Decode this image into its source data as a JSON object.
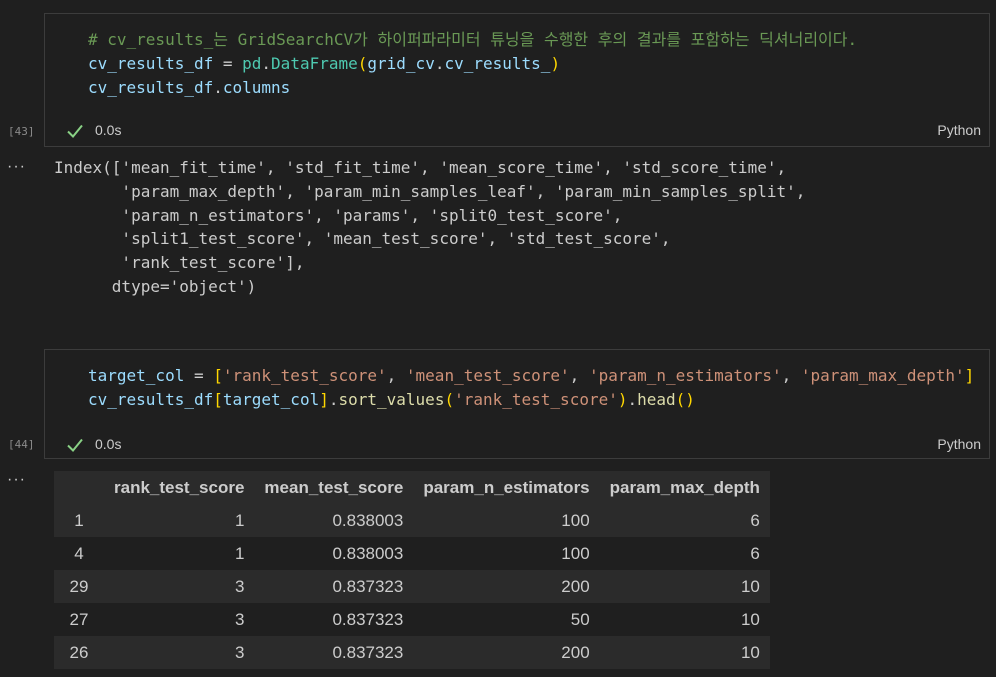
{
  "cell1": {
    "exec_count": "[43]",
    "comment": "# cv_results_는 GridSearchCV가 하이퍼파라미터 튜닝을 수행한 후의 결과를 포함하는 딕셔너리이다.",
    "line2": {
      "var": "cv_results_df",
      "op": " = ",
      "mod": "pd",
      "dot": ".",
      "cls": "DataFrame",
      "open": "(",
      "arg1": "grid_cv",
      "dot2": ".",
      "arg2": "cv_results_",
      "close": ")"
    },
    "line3": {
      "var": "cv_results_df",
      "dot": ".",
      "attr": "columns"
    },
    "time": "0.0s",
    "language": "Python"
  },
  "output1": {
    "lines": [
      "Index(['mean_fit_time', 'std_fit_time', 'mean_score_time', 'std_score_time',",
      "       'param_max_depth', 'param_min_samples_leaf', 'param_min_samples_split',",
      "       'param_n_estimators', 'params', 'split0_test_score',",
      "       'split1_test_score', 'mean_test_score', 'std_test_score',",
      "       'rank_test_score'],",
      "      dtype='object')"
    ]
  },
  "cell2": {
    "exec_count": "[44]",
    "line1": {
      "var": "target_col",
      "op": " = ",
      "open": "[",
      "s1": "'rank_test_score'",
      "s2": "'mean_test_score'",
      "s3": "'param_n_estimators'",
      "s4": "'param_max_depth'",
      "sep": ", ",
      "close": "]"
    },
    "line2": {
      "var": "cv_results_df",
      "open": "[",
      "idx": "target_col",
      "close": "]",
      "dot": ".",
      "fn1": "sort_values",
      "p1o": "(",
      "arg": "'rank_test_score'",
      "p1c": ")",
      "dot2": ".",
      "fn2": "head",
      "p2": "()"
    },
    "time": "0.0s",
    "language": "Python"
  },
  "table": {
    "columns": [
      "",
      "rank_test_score",
      "mean_test_score",
      "param_n_estimators",
      "param_max_depth"
    ],
    "rows": [
      [
        "1",
        "1",
        "0.838003",
        "100",
        "6"
      ],
      [
        "4",
        "1",
        "0.838003",
        "100",
        "6"
      ],
      [
        "29",
        "3",
        "0.837323",
        "200",
        "10"
      ],
      [
        "27",
        "3",
        "0.837323",
        "50",
        "10"
      ],
      [
        "26",
        "3",
        "0.837323",
        "200",
        "10"
      ]
    ]
  },
  "ellipsis": "···",
  "icons": {
    "status": "check-icon"
  },
  "colors": {
    "success": "#89d185",
    "comment": "#6a9955",
    "string": "#ce9178",
    "variable": "#9cdcfe",
    "function": "#dcdcaa",
    "class": "#4ec9b0"
  }
}
